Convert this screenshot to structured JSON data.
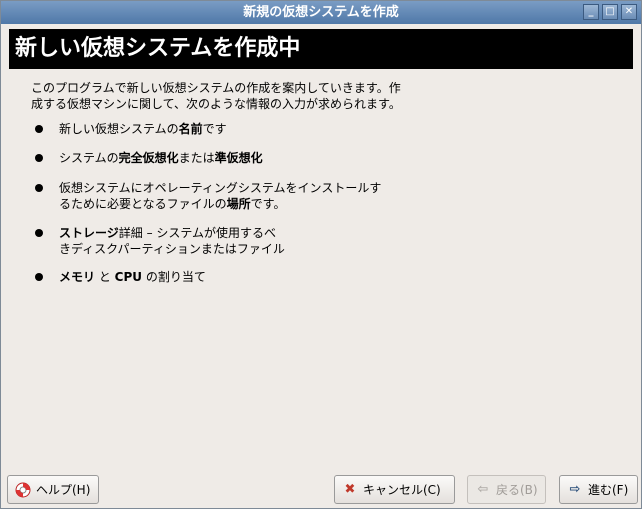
{
  "window": {
    "title": "新規の仮想システムを作成"
  },
  "header": {
    "title": "新しい仮想システムを作成中"
  },
  "intro": {
    "line1": "このプログラムで新しい仮想システムの作成を案内していきます。作",
    "line2": "成する仮想マシンに関して、次のような情報の入力が求められます。"
  },
  "items": [
    {
      "pre": "新しい仮想システムの",
      "bold": "名前",
      "post": "です"
    },
    {
      "pre": "システムの",
      "bold1": "完全仮想化",
      "mid": "または",
      "bold2": "準仮想化"
    },
    {
      "line1": "仮想システムにオペレーティングシステムをインストールす",
      "line2_pre": "るために必要となるファイルの",
      "bold": "場所",
      "post": "です。"
    },
    {
      "bold": "ストレージ",
      "line1_post": "詳細 – システムが使用するべ",
      "line2": "きディスクパーティションまたはファイル"
    },
    {
      "bold1": "メモリ",
      "mid": " と ",
      "bold2": "CPU",
      "post": " の割り当て"
    }
  ],
  "buttons": {
    "help": "ヘルプ(H)",
    "cancel": "キャンセル(C)",
    "back": "戻る(B)",
    "forward": "進む(F)"
  },
  "icons": {
    "help": "lifebuoy-icon",
    "cancel": "close-icon",
    "back": "arrow-left-icon",
    "forward": "arrow-right-icon"
  }
}
